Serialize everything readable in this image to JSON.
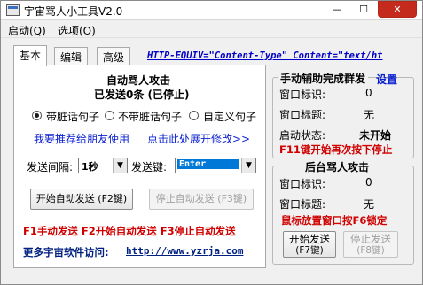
{
  "window": {
    "title": "宇宙骂人小工具V2.0",
    "close_label": "✕",
    "max_label": "☐",
    "min_label": "—"
  },
  "menu": [
    {
      "label": "启动(Q)"
    },
    {
      "label": "选项(O)"
    }
  ],
  "tabs": [
    {
      "label": "基本",
      "active": true
    },
    {
      "label": "编辑",
      "active": false
    },
    {
      "label": "高级",
      "active": false
    }
  ],
  "http_equiv_text": "HTTP-EQUIV=\"Content-Type\" Content=\"text/ht",
  "auto_attack": {
    "title": "自动骂人攻击",
    "status": "已发送0条 (已停止)",
    "radio_options": [
      {
        "label": "带脏话句子",
        "selected": true
      },
      {
        "label": "不带脏话句子",
        "selected": false
      },
      {
        "label": "自定义句子",
        "selected": false
      }
    ],
    "recommend_link": "我要推荐给朋友使用",
    "expand_link": "点击此处展开修改>>",
    "interval_label": "发送间隔:",
    "interval_value": "1秒",
    "key_label": "发送键:",
    "key_value": "Enter",
    "start_button": "开始自动发送 (F2键)",
    "stop_button": "停止自动发送 (F3键)",
    "hotkeys_text": "F1手动发送  F2开始自动发送  F3停止自动发送",
    "visit_label": "更多宇宙软件访问:",
    "visit_url": "http://www.yzrja.com"
  },
  "manual_group": {
    "title": "手动辅助完成群发",
    "settings_link": "设置",
    "window_id_label": "窗口标识:",
    "window_id_value": "0",
    "window_title_label": "窗口标题:",
    "window_title_value": "无",
    "start_state_label": "启动状态:",
    "start_state_value": "未开始",
    "f11_hint": "F11键开始再次按下停止"
  },
  "background_group": {
    "title": "后台骂人攻击",
    "window_id_label": "窗口标识:",
    "window_id_value": "0",
    "window_title_label": "窗口标题:",
    "window_title_value": "无",
    "f6_hint": "鼠标放置窗口按F6锁定",
    "start_button_line1": "开始发送",
    "start_button_line2": "(F7键)",
    "stop_button_line1": "停止发送",
    "stop_button_line2": "(F8键)"
  },
  "colors": {
    "red": "#d00000",
    "blue_link": "#0a20d0",
    "navy": "#002080",
    "close_red": "#c42b1c",
    "selection_blue": "#0078d7"
  }
}
